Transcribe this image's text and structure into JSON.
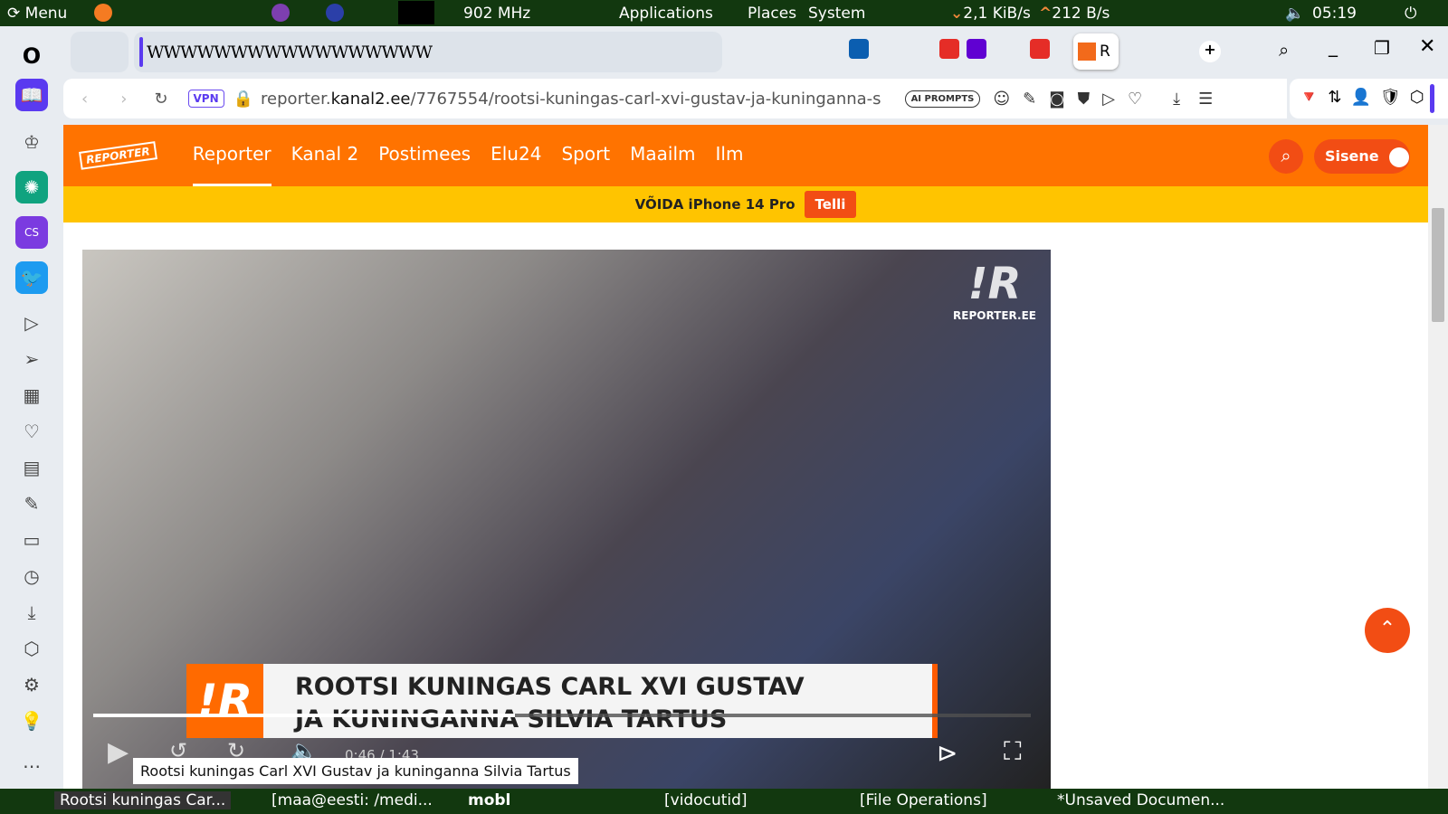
{
  "topbar": {
    "menu": "Menu",
    "cpu": "902 MHz",
    "applications": "Applications",
    "places": "Places",
    "system": "System",
    "net_down": "2,1 KiB/s",
    "net_up": "212 B/s",
    "clock": "05:19"
  },
  "tabs": {
    "pinned_text": "WWWWWWWWWWWWWWWWW",
    "active_tab": "R"
  },
  "address": {
    "vpn": "VPN",
    "domain_pre": "reporter.",
    "domain": "kanal2.ee",
    "path": "/7767554/rootsi-kuningas-carl-xvi-gustav-ja-kuninganna-s",
    "ai_prompts": "AI PROMPTS"
  },
  "site": {
    "logo": "REPORTER",
    "nav": [
      "Reporter",
      "Kanal 2",
      "Postimees",
      "Elu24",
      "Sport",
      "Maailm",
      "Ilm"
    ],
    "login": "Sisene",
    "banner": "VÕIDA iPhone 14 Pro",
    "banner_button": "Telli"
  },
  "video": {
    "watermark": "REPORTER.EE",
    "headline_1": "ROOTSI KUNINGAS CARL XVI GUSTAV",
    "headline_2": "JA KUNINGANNA SILVIA TARTUS",
    "time": "0:46 / 1:43",
    "progress": 0.45,
    "tooltip": "Rootsi kuningas Carl XVI Gustav ja kuninganna Silvia Tartus"
  },
  "taskbar": [
    "Rootsi kuningas Car...",
    "[maa@eesti: /medi...",
    "mobl",
    "[vidocutid]",
    "[File Operations]",
    "*Unsaved Documen..."
  ],
  "colors": {
    "accent": "#ff7300",
    "banner": "#ffc400",
    "panel": "#12380f"
  }
}
